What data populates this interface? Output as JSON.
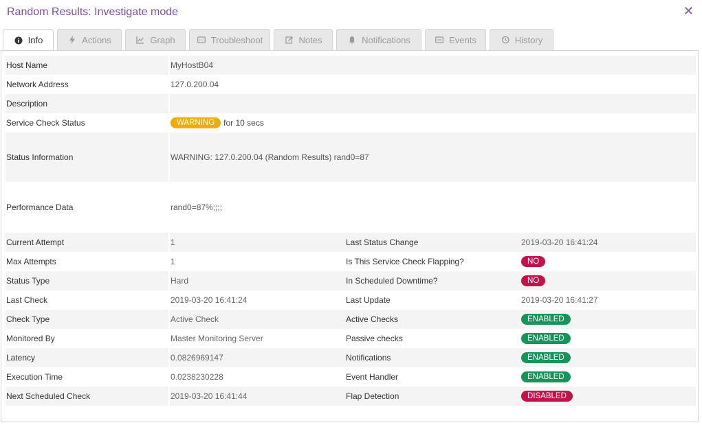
{
  "header": {
    "title": "Random Results: Investigate mode"
  },
  "tabs": [
    {
      "label": "Info",
      "icon": "info-icon"
    },
    {
      "label": "Actions",
      "icon": "bolt-icon"
    },
    {
      "label": "Graph",
      "icon": "chart-icon"
    },
    {
      "label": "Troubleshoot",
      "icon": "terminal-icon"
    },
    {
      "label": "Notes",
      "icon": "edit-icon"
    },
    {
      "label": "Notifications",
      "icon": "bell-icon"
    },
    {
      "label": "Events",
      "icon": "window-icon"
    },
    {
      "label": "History",
      "icon": "history-icon"
    }
  ],
  "info": {
    "host_name": {
      "label": "Host Name",
      "value": "MyHostB04"
    },
    "network_address": {
      "label": "Network Address",
      "value": "127.0.200.04"
    },
    "description": {
      "label": "Description",
      "value": ""
    },
    "service_check_status": {
      "label": "Service Check Status",
      "badge": "WARNING",
      "suffix": "for 10 secs"
    },
    "status_information": {
      "label": "Status Information",
      "value": "WARNING: 127.0.200.04 (Random Results) rand0=87"
    },
    "performance_data": {
      "label": "Performance Data",
      "value": "rand0=87%;;;;"
    }
  },
  "details": [
    {
      "l1": "Current Attempt",
      "v1": "1",
      "l2": "Last Status Change",
      "v2": "2019-03-20 16:41:24"
    },
    {
      "l1": "Max Attempts",
      "v1": "1",
      "l2": "Is This Service Check Flapping?",
      "badge2": "NO",
      "kind2": "no"
    },
    {
      "l1": "Status Type",
      "v1": "Hard",
      "l2": "In Scheduled Downtime?",
      "badge2": "NO",
      "kind2": "no"
    },
    {
      "l1": "Last Check",
      "v1": "2019-03-20 16:41:24",
      "l2": "Last Update",
      "v2": "2019-03-20 16:41:27"
    },
    {
      "l1": "Check Type",
      "v1": "Active Check",
      "l2": "Active Checks",
      "badge2": "ENABLED",
      "kind2": "enabled"
    },
    {
      "l1": "Monitored By",
      "v1": "Master Monitoring Server",
      "l2": "Passive checks",
      "badge2": "ENABLED",
      "kind2": "enabled"
    },
    {
      "l1": "Latency",
      "v1": "0.0826969147",
      "l2": "Notifications",
      "badge2": "ENABLED",
      "kind2": "enabled"
    },
    {
      "l1": "Execution Time",
      "v1": "0.0238230228",
      "l2": "Event Handler",
      "badge2": "ENABLED",
      "kind2": "enabled"
    },
    {
      "l1": "Next Scheduled Check",
      "v1": "2019-03-20 16:41:44",
      "l2": "Flap Detection",
      "badge2": "DISABLED",
      "kind2": "disabled"
    }
  ],
  "colors": {
    "title": "#7b4ea3",
    "warning": "#f0ad00",
    "no": "#c5114a",
    "enabled": "#15955a",
    "disabled": "#c5114a"
  }
}
